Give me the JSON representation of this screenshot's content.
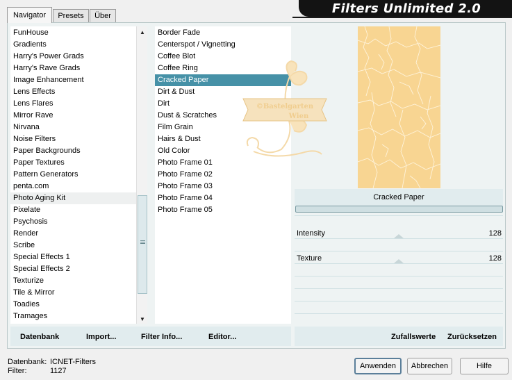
{
  "app": {
    "title": "Filters Unlimited 2.0"
  },
  "tabs": [
    {
      "label": "Navigator",
      "active": true
    },
    {
      "label": "Presets",
      "active": false
    },
    {
      "label": "Über",
      "active": false
    }
  ],
  "categories": [
    "FunHouse",
    "Gradients",
    "Harry's Power Grads",
    "Harry's Rave Grads",
    "Image Enhancement",
    "Lens Effects",
    "Lens Flares",
    "Mirror Rave",
    "Nirvana",
    "Noise Filters",
    "Paper Backgrounds",
    "Paper Textures",
    "Pattern Generators",
    "penta.com",
    "Photo Aging Kit",
    "Pixelate",
    "Psychosis",
    "Render",
    "Scribe",
    "Special Effects 1",
    "Special Effects 2",
    "Texturize",
    "Tile & Mirror",
    "Toadies",
    "Tramages"
  ],
  "current_category": "Photo Aging Kit",
  "filters": [
    "Border Fade",
    "Centerspot / Vignetting",
    "Coffee Blot",
    "Coffee Ring",
    "Cracked Paper",
    "Dirt & Dust",
    "Dirt",
    "Dust & Scratches",
    "Film Grain",
    "Hairs & Dust",
    "Old Color",
    "Photo Frame 01",
    "Photo Frame 02",
    "Photo Frame 03",
    "Photo Frame 04",
    "Photo Frame 05"
  ],
  "selected_filter": "Cracked Paper",
  "watermark": {
    "line1": "©Bastelgarten",
    "line2": "Wien"
  },
  "preview": {
    "filter_name": "Cracked Paper",
    "color": "#f8d592"
  },
  "parameters": [
    {
      "label": "Intensity",
      "value": "128",
      "level": 128
    },
    {
      "label": "Texture",
      "value": "128",
      "level": 128
    }
  ],
  "toolbar_left": {
    "datenbank": "Datenbank",
    "import": "Import...",
    "filter_info": "Filter Info...",
    "editor": "Editor..."
  },
  "toolbar_right": {
    "zufallswerte": "Zufallswerte",
    "zuruecksetzen": "Zurücksetzen"
  },
  "status": {
    "db_label": "Datenbank:",
    "db_value": "ICNET-Filters",
    "filter_label": "Filter:",
    "filter_value": "1127"
  },
  "buttons": {
    "apply": "Anwenden",
    "cancel": "Abbrechen",
    "help": "Hilfe"
  },
  "colors": {
    "selection": "#4691a7",
    "banner": "#131313",
    "panel": "#eef3f3"
  }
}
